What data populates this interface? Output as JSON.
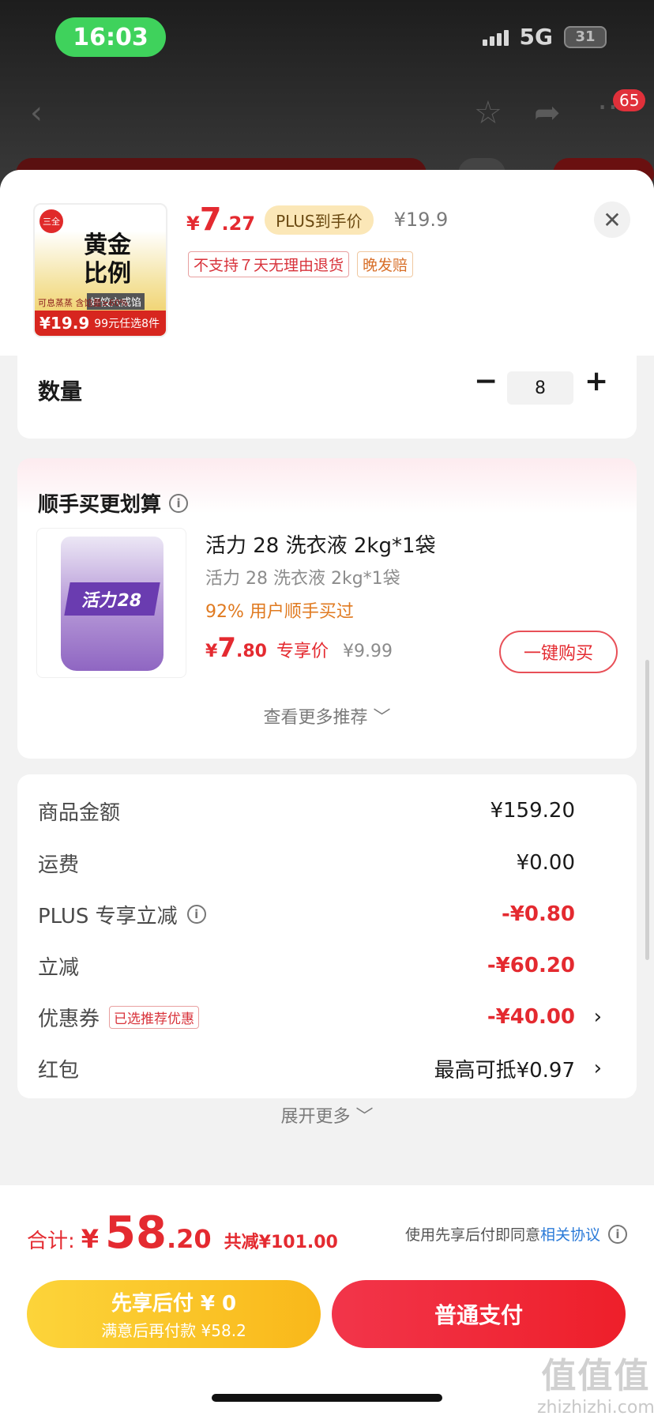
{
  "status_bar": {
    "time": "16:03",
    "network": "5G",
    "battery": "31"
  },
  "nav": {
    "badge_count": "65"
  },
  "product": {
    "thumb_title": "黄金\n比例",
    "thumb_logo": "三全",
    "thumb_tag": "好饺六成馅",
    "thumb_sub": "可息蒸蒸 含馅量≥60%",
    "thumb_price": "¥19.9",
    "thumb_promo": "99元任选8件",
    "price_currency": "¥",
    "price_int": "7",
    "price_dec": ".27",
    "plus_label": "PLUS到手价",
    "original_price": "¥19.9",
    "tag_no_return": "不支持７天无理由退货",
    "tag_late": "晚发赔"
  },
  "quantity": {
    "label": "数量",
    "minus": "−",
    "value": "8",
    "plus": "+"
  },
  "recommend": {
    "title": "顺手买更划算",
    "item_brand": "活力28",
    "item_name": "活力 28 洗衣液 2kg*1袋",
    "item_sub": "活力 28 洗衣液 2kg*1袋",
    "item_rate": "92% 用户顺手买过",
    "price_currency": "¥",
    "price_int": "7",
    "price_dec": ".80",
    "price_label": "专享价",
    "original_price": "¥9.99",
    "buy_label": "一键购买",
    "more_label": "查看更多推荐 ﹀"
  },
  "summary": {
    "rows": [
      {
        "label": "商品金额",
        "value": "¥159.20"
      },
      {
        "label": "运费",
        "value": "¥0.00"
      },
      {
        "label": "PLUS 专享立减",
        "value": "-¥0.80"
      },
      {
        "label": "立减",
        "value": "-¥60.20"
      },
      {
        "label": "优惠券",
        "tag": "已选推荐优惠",
        "value": "-¥40.00"
      },
      {
        "label": "红包",
        "value": "最高可抵¥0.97"
      }
    ],
    "expand_label": "展开更多 ﹀"
  },
  "footer": {
    "total_label": "合计:",
    "total_currency": "¥",
    "total_int": "58",
    "total_dec": ".20",
    "saved": "共减¥101.00",
    "agree_text": "使用先享后付即同意",
    "agree_link": "相关协议",
    "pay_later_line1": "先享后付 ¥ 0",
    "pay_later_line2": "满意后再付款 ¥58.2",
    "pay_normal": "普通支付"
  },
  "watermark": {
    "big": "值值值",
    "small": "zhizhizhi.com"
  }
}
